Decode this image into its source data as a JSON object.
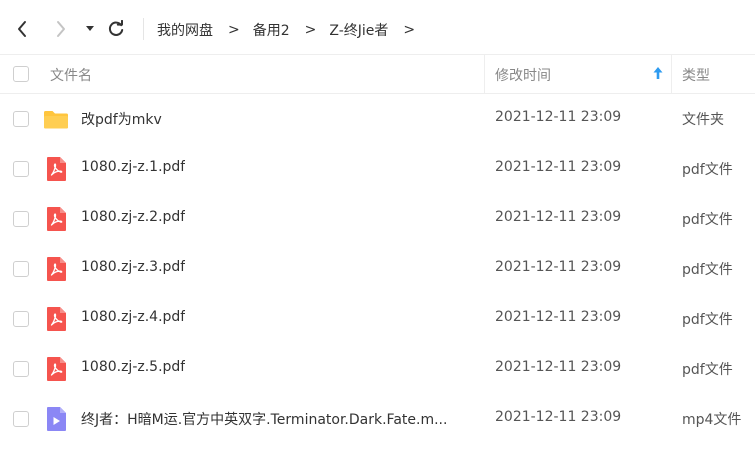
{
  "breadcrumb": [
    "我的网盘",
    "备用2",
    "Z-终Jie者"
  ],
  "breadcrumb_separator": ">",
  "header": {
    "name": "文件名",
    "time": "修改时间",
    "type": "类型"
  },
  "files": [
    {
      "name": "改pdf为mkv",
      "time": "2021-12-11 23:09",
      "type": "文件夹",
      "icon": "folder-icon"
    },
    {
      "name": "1080.zj-z.1.pdf",
      "time": "2021-12-11 23:09",
      "type": "pdf文件",
      "icon": "pdf-icon"
    },
    {
      "name": "1080.zj-z.2.pdf",
      "time": "2021-12-11 23:09",
      "type": "pdf文件",
      "icon": "pdf-icon"
    },
    {
      "name": "1080.zj-z.3.pdf",
      "time": "2021-12-11 23:09",
      "type": "pdf文件",
      "icon": "pdf-icon"
    },
    {
      "name": "1080.zj-z.4.pdf",
      "time": "2021-12-11 23:09",
      "type": "pdf文件",
      "icon": "pdf-icon"
    },
    {
      "name": "1080.zj-z.5.pdf",
      "time": "2021-12-11 23:09",
      "type": "pdf文件",
      "icon": "pdf-icon"
    },
    {
      "name": "终J者：H暗M运.官方中英双字.Terminator.Dark.Fate.m...",
      "time": "2021-12-11 23:09",
      "type": "mp4文件",
      "icon": "video-icon"
    }
  ],
  "colors": {
    "folder": "#FFC53D",
    "pdf": "#F5544E",
    "video": "#8B87F5",
    "sort_arrow": "#2E9BF0"
  },
  "sort": {
    "column": "time",
    "direction": "ascending",
    "icon": "sort-up-arrow-icon"
  }
}
